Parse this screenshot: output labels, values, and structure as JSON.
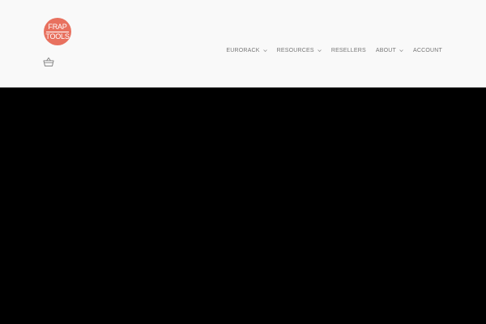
{
  "brand": {
    "logo_line1": "FRAP",
    "logo_line2": "TOOLS",
    "accent_color": "#e8715f"
  },
  "header": {
    "cart_icon": "shopping-basket-icon",
    "nav": {
      "items": [
        {
          "label": "EURORACK",
          "has_dropdown": true
        },
        {
          "label": "RESOURCES",
          "has_dropdown": true
        },
        {
          "label": "RESELLERS",
          "has_dropdown": false
        },
        {
          "label": "ABOUT",
          "has_dropdown": true
        },
        {
          "label": "ACCOUNT",
          "has_dropdown": false
        }
      ]
    }
  },
  "hero": {
    "background_color": "#000000"
  }
}
